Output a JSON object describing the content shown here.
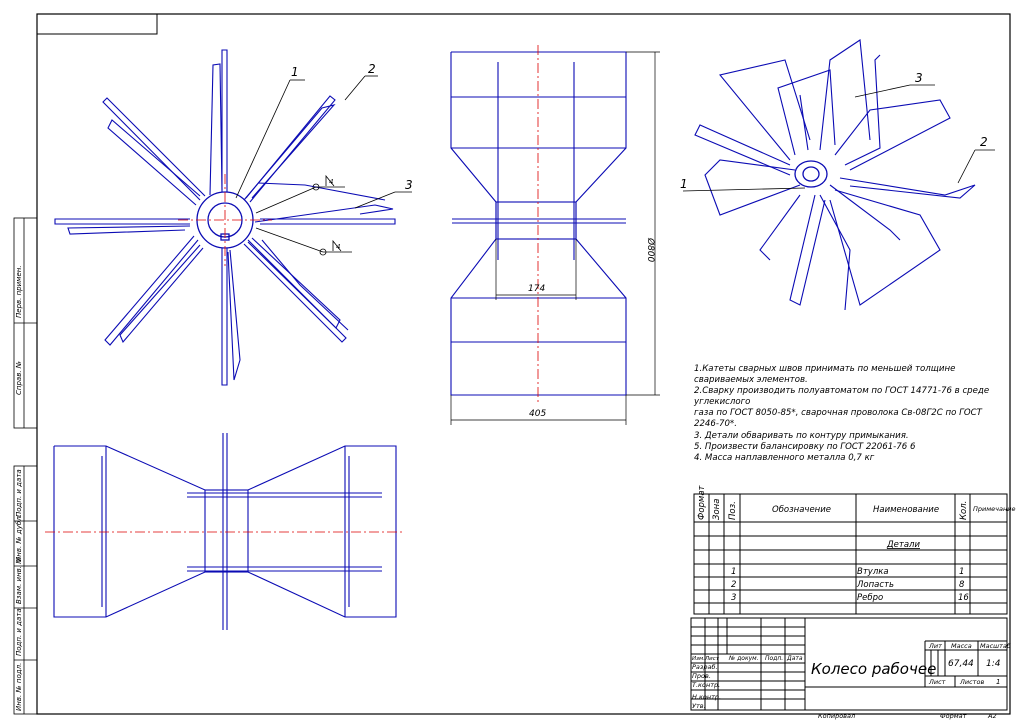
{
  "title_block": {
    "part_name": "Колесо рабочее",
    "lit_label": "Лит",
    "mass_label": "Масса",
    "scale_label": "Масштаб",
    "mass_value": "67,44",
    "scale_value": "1:4",
    "sheet_label": "Лист",
    "sheets_label": "Листов",
    "sheets_value": "1",
    "copied_label": "Копировал",
    "format_label": "Формат",
    "format_value": "А2",
    "rev_cols": [
      "Изм.",
      "Лист",
      "№ докум.",
      "Подп.",
      "Дата"
    ],
    "roles": [
      "Разраб.",
      "Пров.",
      "Т.контр.",
      "",
      "Н.контр.",
      "Утв."
    ]
  },
  "spec_table": {
    "headers": [
      "Формат",
      "Зона",
      "Поз.",
      "Обозначение",
      "Наименование",
      "Кол.",
      "Примечание"
    ],
    "section": "Детали",
    "rows": [
      {
        "pos": "1",
        "name": "Втулка",
        "qty": "1"
      },
      {
        "pos": "2",
        "name": "Лопасть",
        "qty": "8"
      },
      {
        "pos": "3",
        "name": "Ребро",
        "qty": "16"
      }
    ]
  },
  "notes": [
    "1.Катеты сварных швов принимать по меньшей толщине",
    "свариваемых элементов.",
    "2.Сварку производить полуавтоматом по ГОСТ 14771-76 в среде",
    "углекислого",
    "   газа по ГОСТ 8050-85*,  сварочная проволока Св-08Г2С по ГОСТ",
    "2246-70*.",
    "3. Детали обваривать по контуру примыкания.",
    "5. Произвести балансировку по ГОСТ 22061-76 6",
    "4. Масса наплавленного металла 0,7 кг"
  ],
  "dimensions": {
    "hub_width": "174",
    "overall_width": "405",
    "diameter": "Ø800"
  },
  "balloons": {
    "front_1": "1",
    "front_2": "2",
    "front_3": "3",
    "iso_1": "1",
    "iso_2": "2",
    "iso_3": "3",
    "weld_1": "4",
    "weld_2": "4"
  },
  "side_stamps": [
    "Перв. примен.",
    "Справ. №",
    "Подп. и дата",
    "Инв. № дубл.",
    "Взам. инв. №",
    "Подп. и дата",
    "Инв. № подл."
  ],
  "colors": {
    "line": "#0b0bb4",
    "axis": "#dd0000",
    "frame": "#000000"
  }
}
